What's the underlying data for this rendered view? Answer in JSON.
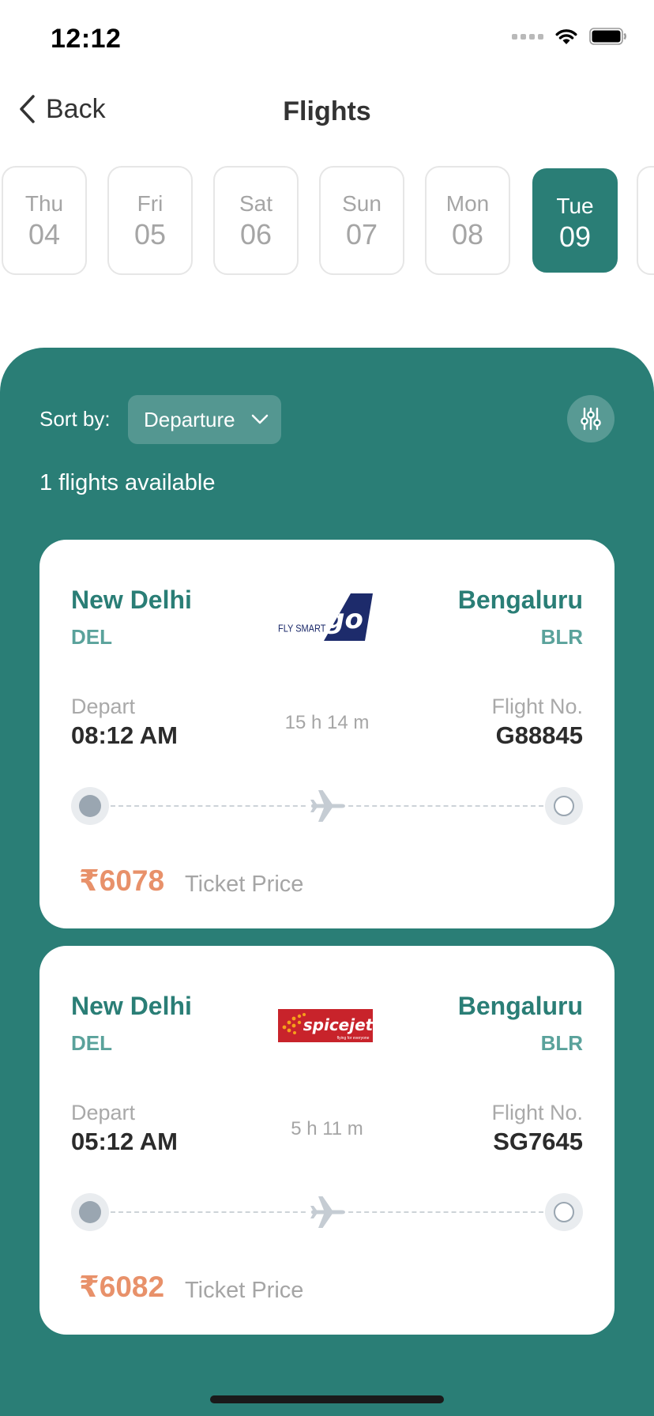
{
  "status_bar": {
    "time": "12:12"
  },
  "nav": {
    "back_label": "Back",
    "title": "Flights"
  },
  "dates": [
    {
      "dow": "Thu",
      "day": "04",
      "selected": false
    },
    {
      "dow": "Fri",
      "day": "05",
      "selected": false
    },
    {
      "dow": "Sat",
      "day": "06",
      "selected": false
    },
    {
      "dow": "Sun",
      "day": "07",
      "selected": false
    },
    {
      "dow": "Mon",
      "day": "08",
      "selected": false
    },
    {
      "dow": "Tue",
      "day": "09",
      "selected": true
    }
  ],
  "results": {
    "sort_label": "Sort by:",
    "sort_value": "Departure",
    "count_text": "1 flights available"
  },
  "flights": [
    {
      "airline_logo": "goair-logo",
      "logo_text": "FLY SMART",
      "logo_mark": "go",
      "from_city": "New Delhi",
      "from_code": "DEL",
      "to_city": "Bengaluru",
      "to_code": "BLR",
      "depart_label": "Depart",
      "depart_time": "08:12 AM",
      "duration": "15 h 14 m",
      "flightno_label": "Flight No.",
      "flight_no": "G88845",
      "price": "₹6078",
      "price_label": "Ticket Price"
    },
    {
      "airline_logo": "spicejet-logo",
      "logo_text": "spicejet",
      "logo_tagline": "flying for everyone",
      "from_city": "New Delhi",
      "from_code": "DEL",
      "to_city": "Bengaluru",
      "to_code": "BLR",
      "depart_label": "Depart",
      "depart_time": "05:12 AM",
      "duration": "5 h 11 m",
      "flightno_label": "Flight No.",
      "flight_no": "SG7645",
      "price": "₹6082",
      "price_label": "Ticket Price"
    }
  ],
  "colors": {
    "primary": "#2a7e76",
    "price": "#e8916a",
    "muted": "#a5a5a5"
  }
}
